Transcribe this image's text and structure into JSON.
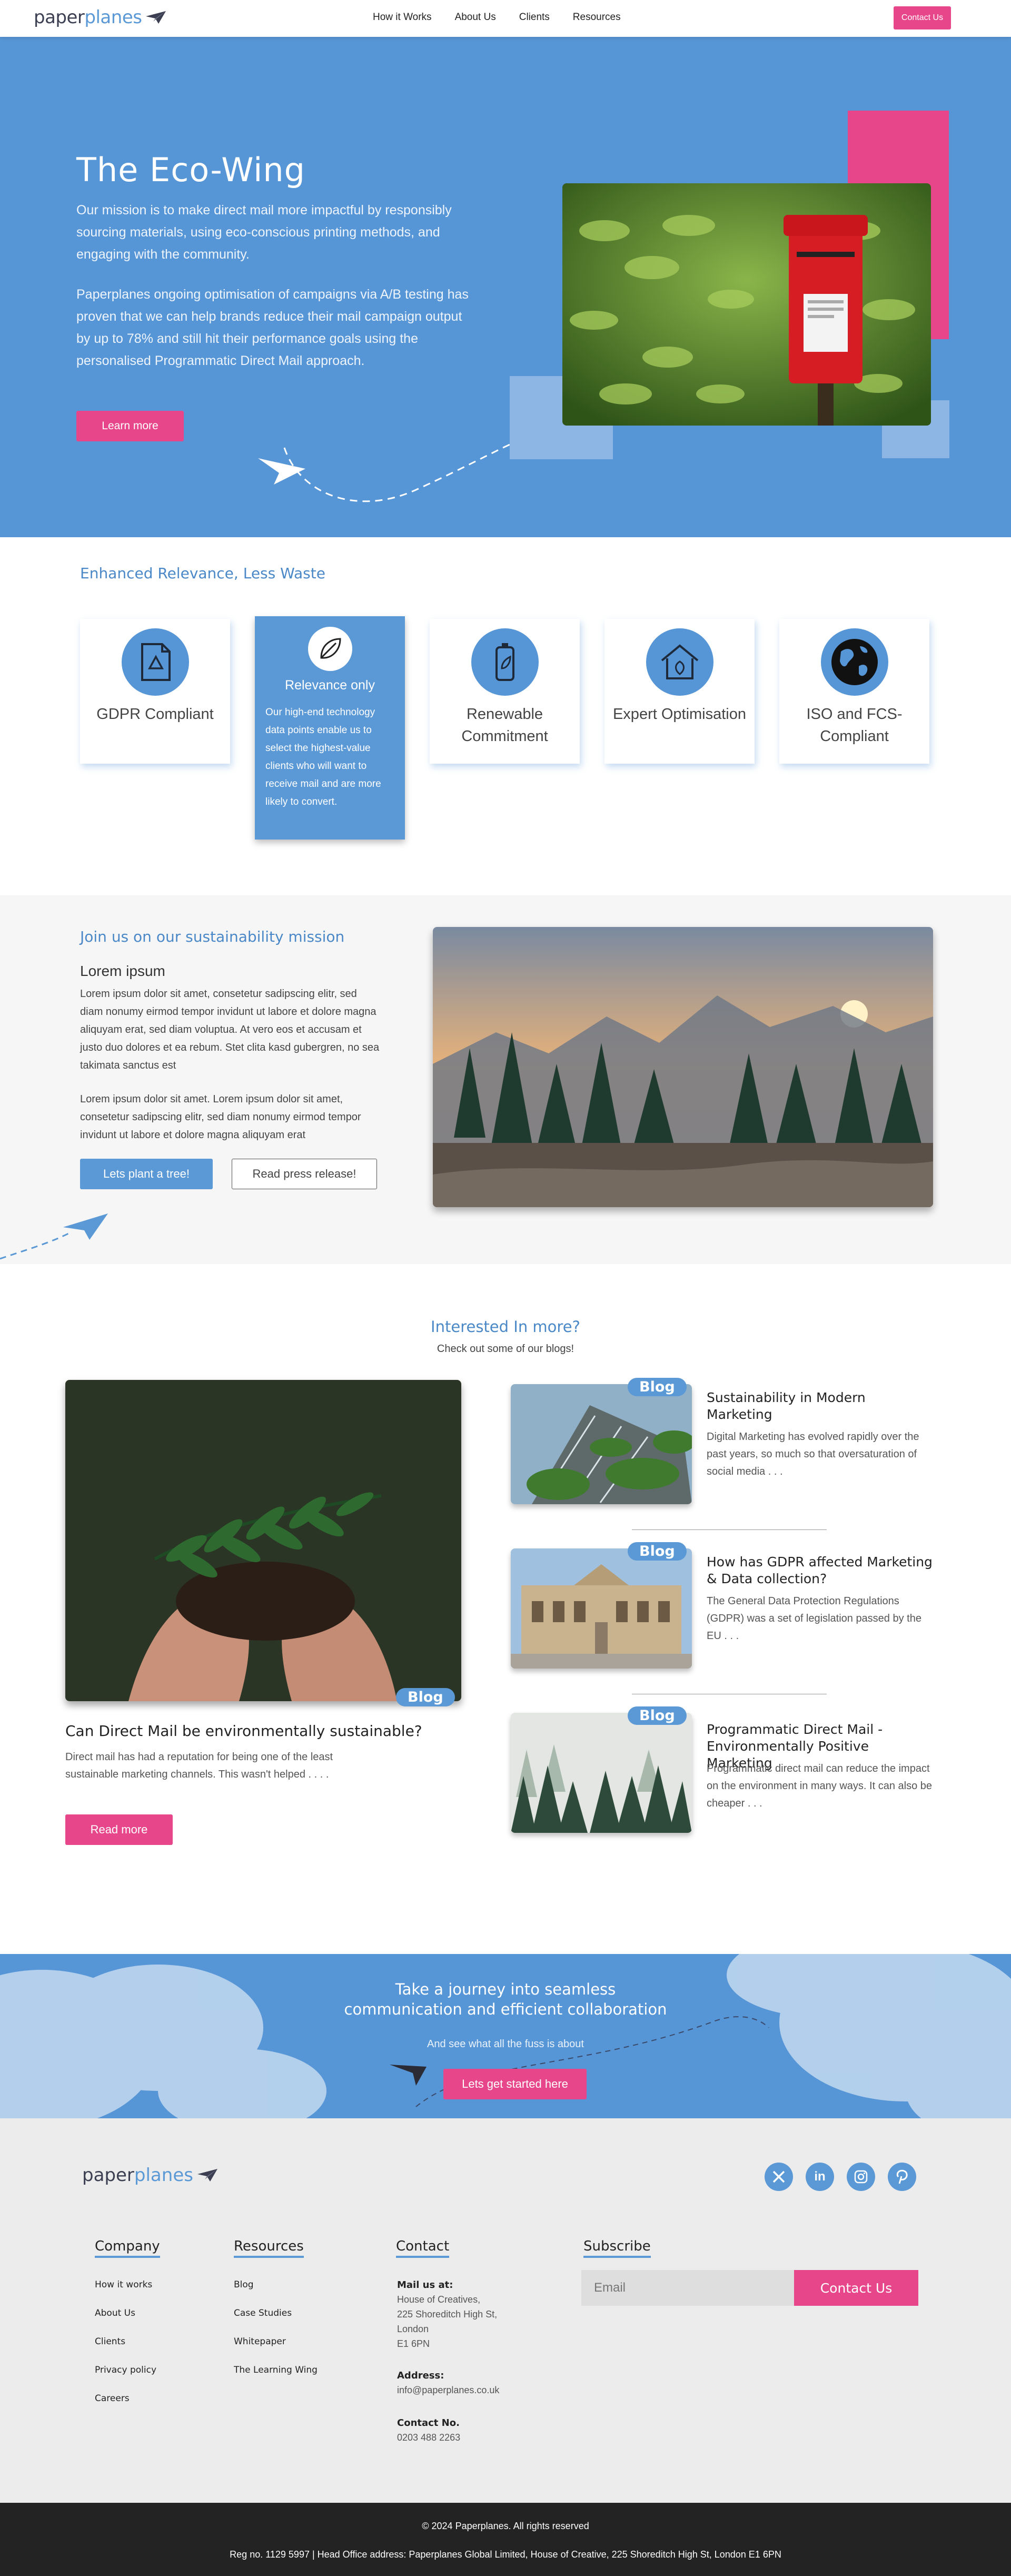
{
  "brand": {
    "logo_part1": "paper",
    "logo_part2": "planes"
  },
  "nav": {
    "links": [
      "How it Works",
      "About Us",
      "Clients",
      "Resources"
    ],
    "cta": "Contact Us"
  },
  "hero": {
    "title": "The Eco-Wing",
    "para1": "Our mission is to make direct mail more impactful by responsibly sourcing materials, using eco-conscious printing methods, and engaging with the community.",
    "para2": "Paperplanes ongoing optimisation of campaigns via A/B testing has proven that we can help brands reduce their mail campaign output by up to 78% and still hit their performance goals using the personalised Programmatic Direct Mail approach.",
    "button": "Learn more"
  },
  "features": {
    "heading": "Enhanced Relevance, Less Waste",
    "cards": [
      {
        "label": "GDPR Compliant",
        "icon": "gdpr-document-icon"
      },
      {
        "label": "Relevance only",
        "icon": "leaf-icon",
        "desc": "Our high-end technology data points enable us to select the highest-value clients who will want to receive mail and are more likely to convert."
      },
      {
        "label": "Renewable Commitment",
        "icon": "renewable-battery-icon"
      },
      {
        "label": "Expert Optimisation",
        "icon": "eco-house-icon"
      },
      {
        "label": "ISO and FCS-Compliant",
        "icon": "globe-icon"
      }
    ]
  },
  "mission": {
    "heading": "Join us on our sustainability mission",
    "subheading": "Lorem ipsum",
    "para1": "Lorem ipsum dolor sit amet, consetetur sadipscing elitr, sed diam nonumy eirmod tempor invidunt ut labore et dolore magna aliquyam erat, sed diam voluptua. At vero eos et accusam et justo duo dolores et ea rebum. Stet clita kasd gubergren, no sea takimata sanctus est",
    "para2": "Lorem ipsum dolor sit amet. Lorem ipsum dolor sit amet, consetetur sadipscing elitr, sed diam nonumy eirmod tempor invidunt ut labore et dolore magna aliquyam erat",
    "button_primary": "Lets plant a tree!",
    "button_secondary": "Read press release!"
  },
  "blogs": {
    "heading": "Interested In more?",
    "subheading": "Check out some of our blogs!",
    "badge": "Blog",
    "main": {
      "title": "Can Direct Mail be environmentally sustainable?",
      "desc": "Direct mail has had a reputation for being one of the least sustainable marketing channels. This wasn't helped . . . .",
      "button": "Read more"
    },
    "posts": [
      {
        "title": "Sustainability in Modern Marketing",
        "desc": "Digital Marketing has evolved rapidly over the past years, so much so that oversaturation of social media . . ."
      },
      {
        "title": "How has GDPR affected Marketing & Data collection?",
        "desc": "The General Data Protection Regulations (GDPR) was a set of legislation passed by the EU . . ."
      },
      {
        "title": "Programmatic Direct Mail - Environmentally Positive Marketing",
        "desc": "Programmatic direct mail can reduce the impact on the environment in many ways. It can also be cheaper . . ."
      }
    ]
  },
  "cta": {
    "title_line1": "Take a journey into seamless",
    "title_line2": "communication and efficient collaboration",
    "sub": "And see what all the fuss is about",
    "button": "Lets get started here"
  },
  "footer": {
    "social": [
      "x-icon",
      "linkedin-icon",
      "instagram-icon",
      "pinterest-icon"
    ],
    "company": {
      "heading": "Company",
      "links": [
        "How it works",
        "About Us",
        "Clients",
        "Privacy policy",
        "Careers"
      ]
    },
    "resources": {
      "heading": "Resources",
      "links": [
        "Blog",
        "Case Studies",
        "Whitepaper",
        "The Learning Wing"
      ]
    },
    "contact": {
      "heading": "Contact",
      "mail_label": "Mail us at:",
      "mail_lines": [
        "House of Creatives,",
        "225 Shoreditch High St,",
        "London",
        "E1 6PN"
      ],
      "address_label": "Address:",
      "address": "info@paperplanes.co.uk",
      "phone_label": "Contact No.",
      "phone": "0203 488 2263"
    },
    "subscribe": {
      "heading": "Subscribe",
      "placeholder": "Email",
      "button": "Contact Us"
    },
    "copyright": "© 2024 Paperplanes. All rights reserved",
    "legal": "Reg no. 1129 5997 | Head Office address: Paperplanes Global Limited, House of Creative, 225 Shoreditch High St, London E1 6PN"
  },
  "colors": {
    "brand_blue": "#5695d6",
    "accent_pink": "#e8468a",
    "dark": "#232323"
  }
}
